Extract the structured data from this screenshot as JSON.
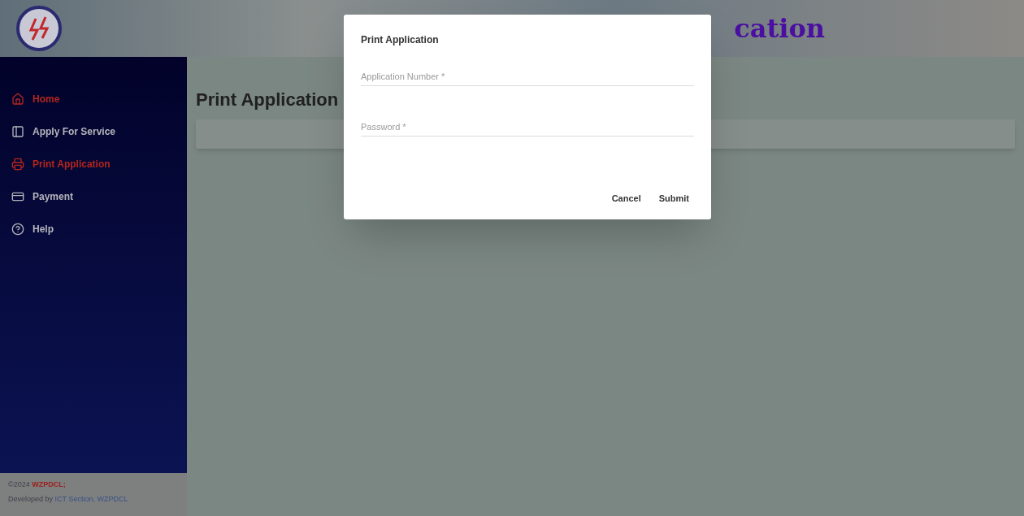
{
  "header": {
    "title": "cation"
  },
  "sidebar": {
    "items": [
      {
        "label": "Home",
        "kind": "home",
        "selected": true
      },
      {
        "label": "Apply For Service",
        "kind": "card",
        "selected": false
      },
      {
        "label": "Print Application",
        "kind": "printer",
        "selected": true
      },
      {
        "label": "Payment",
        "kind": "payment",
        "selected": false
      },
      {
        "label": "Help",
        "kind": "help",
        "selected": false
      }
    ]
  },
  "footer": {
    "copyright": "©2024",
    "org": "WZPDCL;",
    "developed_by": "Developed by",
    "developer": "ICT Section, WZPDCL"
  },
  "page": {
    "title": "Print Application"
  },
  "dialog": {
    "title": "Print Application",
    "fields": [
      {
        "placeholder": "Application Number *"
      },
      {
        "placeholder": "Password *"
      }
    ],
    "buttons": [
      "Cancel",
      "Submit"
    ]
  }
}
